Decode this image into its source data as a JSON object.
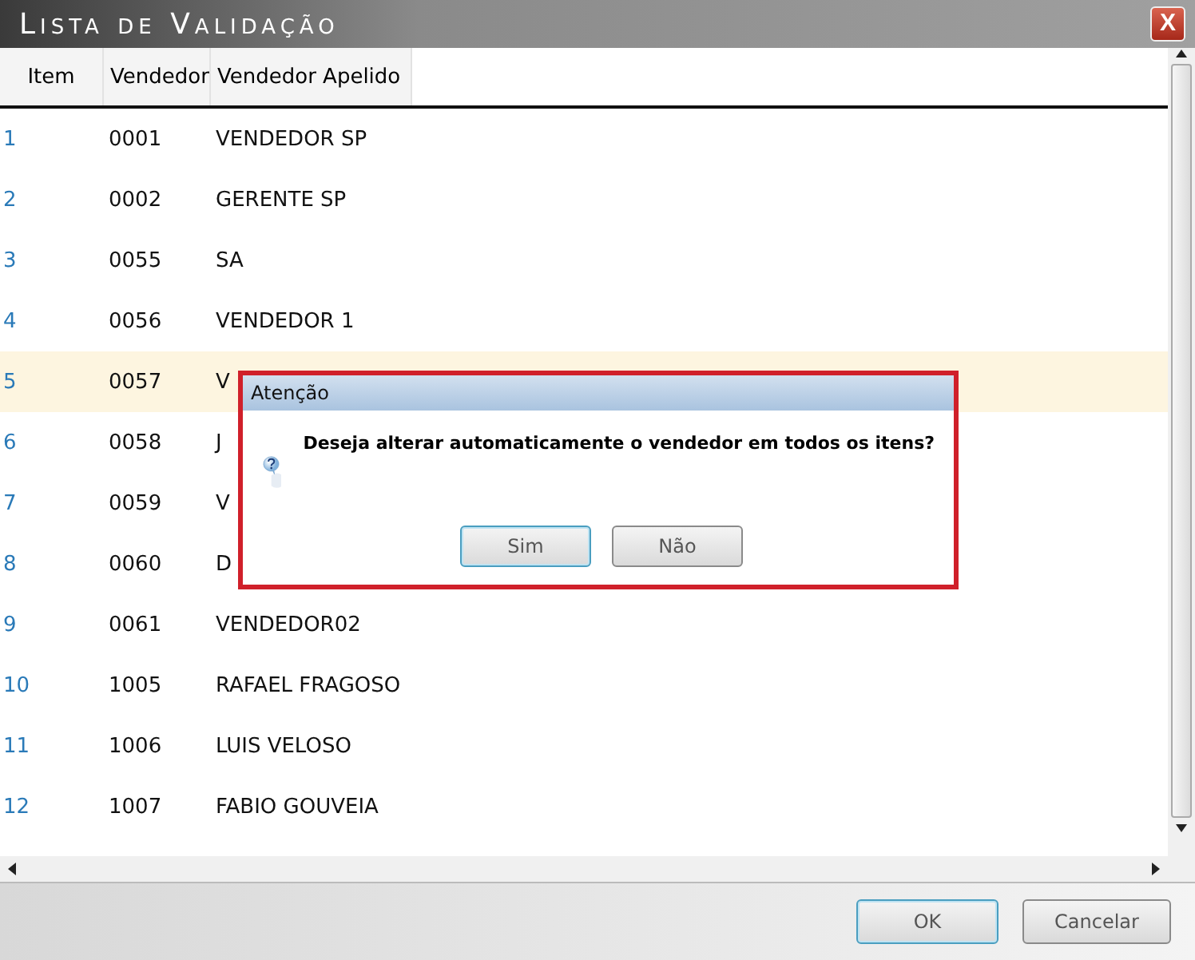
{
  "window": {
    "title": "Lista de Validação",
    "close": "X"
  },
  "table": {
    "columns": [
      "Item",
      "Vendedor",
      "Vendedor Apelido"
    ],
    "rows": [
      {
        "item": "1",
        "vendedor": "0001",
        "apelido": "VENDEDOR SP",
        "selected": false
      },
      {
        "item": "2",
        "vendedor": "0002",
        "apelido": "GERENTE SP",
        "selected": false
      },
      {
        "item": "3",
        "vendedor": "0055",
        "apelido": "SA",
        "selected": false
      },
      {
        "item": "4",
        "vendedor": "0056",
        "apelido": "VENDEDOR 1",
        "selected": false
      },
      {
        "item": "5",
        "vendedor": "0057",
        "apelido": "V",
        "selected": true
      },
      {
        "item": "6",
        "vendedor": "0058",
        "apelido": "J",
        "selected": false
      },
      {
        "item": "7",
        "vendedor": "0059",
        "apelido": "V",
        "selected": false
      },
      {
        "item": "8",
        "vendedor": "0060",
        "apelido": "D",
        "selected": false
      },
      {
        "item": "9",
        "vendedor": "0061",
        "apelido": "VENDEDOR02",
        "selected": false
      },
      {
        "item": "10",
        "vendedor": "1005",
        "apelido": "RAFAEL FRAGOSO",
        "selected": false
      },
      {
        "item": "11",
        "vendedor": "1006",
        "apelido": "LUIS VELOSO",
        "selected": false
      },
      {
        "item": "12",
        "vendedor": "1007",
        "apelido": "FABIO GOUVEIA",
        "selected": false
      }
    ]
  },
  "dialog": {
    "title": "Atenção",
    "message": "Deseja alterar automaticamente o vendedor em todos os itens?",
    "buttons": [
      {
        "label": "Sim",
        "focused": true
      },
      {
        "label": "Não",
        "focused": false
      }
    ]
  },
  "footer": {
    "buttons": [
      {
        "label": "OK",
        "focused": true
      },
      {
        "label": "Cancelar",
        "focused": false
      }
    ]
  }
}
